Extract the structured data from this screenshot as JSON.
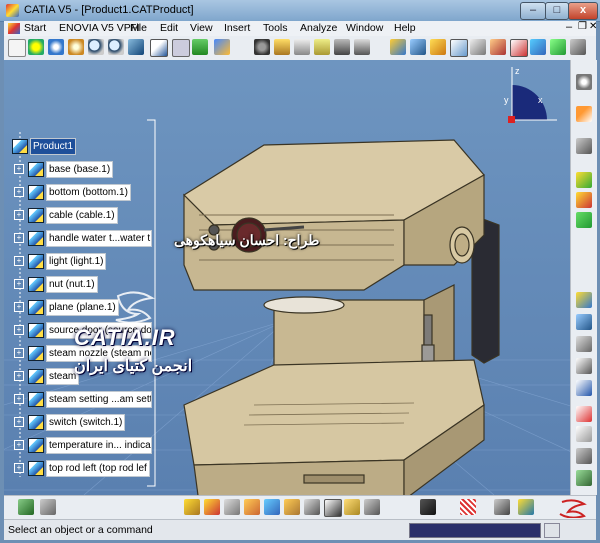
{
  "window": {
    "title": "CATIA V5 - [Product1.CATProduct]",
    "minimize": "–",
    "maximize": "□",
    "close": "x"
  },
  "menu": [
    "Start",
    "ENOVIA V5 VPM",
    "File",
    "Edit",
    "View",
    "Insert",
    "Tools",
    "Analyze",
    "Window",
    "Help"
  ],
  "tree": {
    "root": "Product1",
    "items": [
      "base (base.1)",
      "bottom (bottom.1)",
      "cable (cable.1)",
      "handle water t...water t",
      "light (light.1)",
      "nut (nut.1)",
      "plane (plane.1)",
      "source door (source do",
      "steam nozzle (steam no",
      "steam",
      "steam setting ...am sett",
      "switch (switch.1)",
      "temperature in... indica",
      "top rod left (top rod lef"
    ]
  },
  "overlay": {
    "designer_credit": "طراح: احسان سیاهکوهی",
    "watermark_site": "CATIA.IR",
    "watermark_assoc": "انجمن کتیای ایران"
  },
  "compass": {
    "x_label": "x",
    "y_label": "y",
    "z_label": "z"
  },
  "status": {
    "prompt": "Select an object or a command"
  },
  "colors": {
    "viewport": "#5f86b4",
    "machine_body": "#c9b893",
    "tree_selected": "#1e4f9a",
    "title_bar": "#8fb0d0"
  },
  "icons": {
    "top_toolbar": [
      "select-icon",
      "fit-all-icon",
      "pan-icon",
      "rotate-icon",
      "zoom-in-icon",
      "zoom-out-icon",
      "normal-view-icon",
      "multi-view-icon",
      "hide-show-icon",
      "swap-visible-icon",
      "shading-icon",
      "catalog-icon",
      "product-icon",
      "assembly-icon",
      "constraint-icon",
      "measure-icon",
      "snap-icon",
      "explode-icon",
      "clash-icon",
      "section-icon",
      "scene-icon"
    ],
    "right_toolbar": [
      "compass-icon",
      "select-arrow-icon",
      "component-icon",
      "product-icon",
      "part-icon",
      "existing-component-icon",
      "replace-icon",
      "graph-tree-icon",
      "renumber-icon",
      "multi-instantiate-icon",
      "manipulate-icon",
      "snap-icon",
      "annotation-icon",
      "flag-note-icon",
      "scene-icon"
    ],
    "bottom_toolbar": [
      "undo-icon",
      "redo-icon",
      "update-icon",
      "constraint-icon",
      "fix-icon",
      "contact-icon",
      "offset-icon",
      "angle-icon",
      "reuse-pattern-icon",
      "annotation-icon",
      "bom-icon",
      "save-icon",
      "grid-icon",
      "measure-icon",
      "space-analysis-icon"
    ]
  }
}
